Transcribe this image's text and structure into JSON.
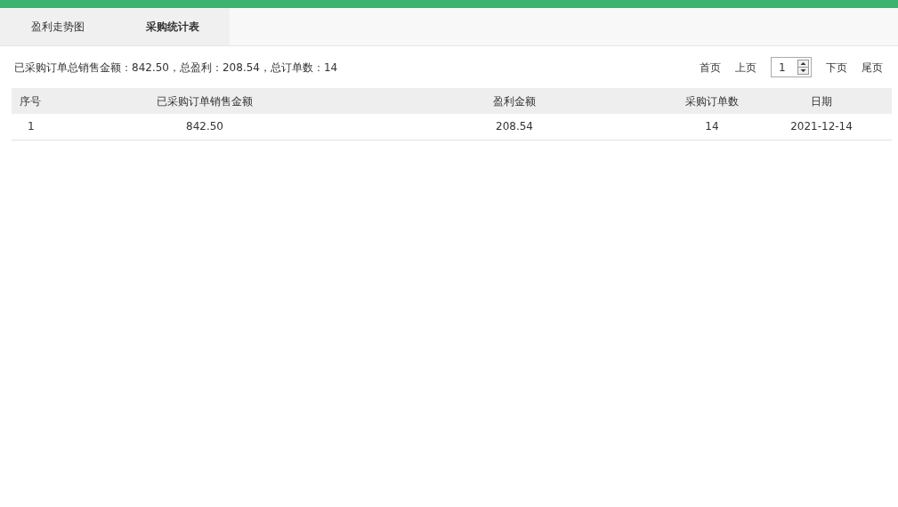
{
  "tabs": [
    {
      "label": "盈利走势图",
      "selected": false
    },
    {
      "label": "采购统计表",
      "selected": true
    }
  ],
  "summary": "已采购订单总销售金额：842.50，总盈利：208.54，总订单数：14",
  "pager": {
    "first": "首页",
    "prev": "上页",
    "page": "1",
    "next": "下页",
    "last": "尾页"
  },
  "table": {
    "columns": [
      "序号",
      "已采购订单销售金额",
      "盈利金额",
      "采购订单数",
      "日期"
    ],
    "rows": [
      [
        "1",
        "842.50",
        "208.54",
        "14",
        "2021-12-14"
      ]
    ]
  }
}
